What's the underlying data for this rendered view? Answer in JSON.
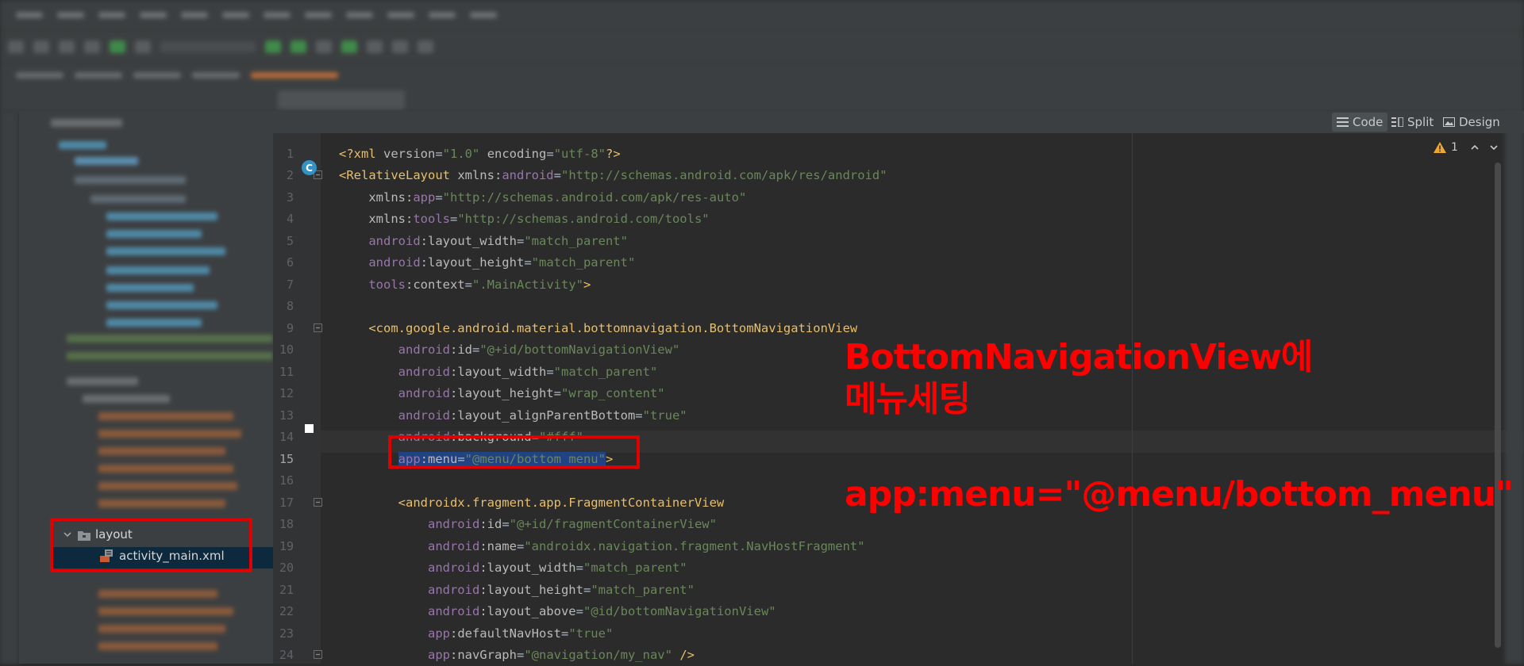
{
  "editor": {
    "view_modes": [
      "Code",
      "Split",
      "Design"
    ],
    "active_view": "Code",
    "inspection_count": "1",
    "lines": [
      {
        "num": "1",
        "tokens": [
          [
            "pi",
            "<?xml "
          ],
          [
            "at",
            "version"
          ],
          [
            "pl",
            "="
          ],
          [
            "val",
            "\"1.0\""
          ],
          [
            "pl",
            " "
          ],
          [
            "at",
            "encoding"
          ],
          [
            "pl",
            "="
          ],
          [
            "val",
            "\"utf-8\""
          ],
          [
            "pi",
            "?>"
          ]
        ]
      },
      {
        "num": "2",
        "tokens": [
          [
            "tag",
            "<RelativeLayout "
          ],
          [
            "at",
            "xmlns:"
          ],
          [
            "ns",
            "android"
          ],
          [
            "pl",
            "="
          ],
          [
            "val",
            "\"http://schemas.android.com/apk/res/android\""
          ]
        ]
      },
      {
        "num": "3",
        "tokens": [
          [
            "pl",
            "    "
          ],
          [
            "at",
            "xmlns:"
          ],
          [
            "ns",
            "app"
          ],
          [
            "pl",
            "="
          ],
          [
            "val",
            "\"http://schemas.android.com/apk/res-auto\""
          ]
        ]
      },
      {
        "num": "4",
        "tokens": [
          [
            "pl",
            "    "
          ],
          [
            "at",
            "xmlns:"
          ],
          [
            "ns",
            "tools"
          ],
          [
            "pl",
            "="
          ],
          [
            "val",
            "\"http://schemas.android.com/tools\""
          ]
        ]
      },
      {
        "num": "5",
        "tokens": [
          [
            "pl",
            "    "
          ],
          [
            "ns",
            "android"
          ],
          [
            "at",
            ":layout_width"
          ],
          [
            "pl",
            "="
          ],
          [
            "val",
            "\"match_parent\""
          ]
        ]
      },
      {
        "num": "6",
        "tokens": [
          [
            "pl",
            "    "
          ],
          [
            "ns",
            "android"
          ],
          [
            "at",
            ":layout_height"
          ],
          [
            "pl",
            "="
          ],
          [
            "val",
            "\"match_parent\""
          ]
        ]
      },
      {
        "num": "7",
        "tokens": [
          [
            "pl",
            "    "
          ],
          [
            "ns",
            "tools"
          ],
          [
            "at",
            ":context"
          ],
          [
            "pl",
            "="
          ],
          [
            "val",
            "\".MainActivity\""
          ],
          [
            "tag",
            ">"
          ]
        ]
      },
      {
        "num": "8",
        "tokens": []
      },
      {
        "num": "9",
        "tokens": [
          [
            "pl",
            "    "
          ],
          [
            "tag",
            "<com.google.android.material.bottomnavigation.BottomNavigationView"
          ]
        ]
      },
      {
        "num": "10",
        "tokens": [
          [
            "pl",
            "        "
          ],
          [
            "ns",
            "android"
          ],
          [
            "at",
            ":id"
          ],
          [
            "pl",
            "="
          ],
          [
            "val",
            "\"@+id/bottomNavigationView\""
          ]
        ]
      },
      {
        "num": "11",
        "tokens": [
          [
            "pl",
            "        "
          ],
          [
            "ns",
            "android"
          ],
          [
            "at",
            ":layout_width"
          ],
          [
            "pl",
            "="
          ],
          [
            "val",
            "\"match_parent\""
          ]
        ]
      },
      {
        "num": "12",
        "tokens": [
          [
            "pl",
            "        "
          ],
          [
            "ns",
            "android"
          ],
          [
            "at",
            ":layout_height"
          ],
          [
            "pl",
            "="
          ],
          [
            "val",
            "\"wrap_content\""
          ]
        ]
      },
      {
        "num": "13",
        "tokens": [
          [
            "pl",
            "        "
          ],
          [
            "ns",
            "android"
          ],
          [
            "at",
            ":layout_alignParentBottom"
          ],
          [
            "pl",
            "="
          ],
          [
            "val",
            "\"true\""
          ]
        ]
      },
      {
        "num": "14",
        "tokens": [
          [
            "pl",
            "        "
          ],
          [
            "ns",
            "android"
          ],
          [
            "at",
            ":background"
          ],
          [
            "pl",
            "="
          ],
          [
            "val",
            "\"#fff\""
          ]
        ]
      },
      {
        "num": "15",
        "tokens": [
          [
            "pl",
            "        "
          ],
          [
            "nsS",
            "app"
          ],
          [
            "atS",
            ":menu"
          ],
          [
            "plS",
            "="
          ],
          [
            "valS",
            "\"@menu/bottom_menu\""
          ],
          [
            "tag",
            ">"
          ]
        ]
      },
      {
        "num": "16",
        "tokens": []
      },
      {
        "num": "17",
        "tokens": [
          [
            "pl",
            "        "
          ],
          [
            "tag",
            "<androidx.fragment.app.FragmentContainerView"
          ]
        ]
      },
      {
        "num": "18",
        "tokens": [
          [
            "pl",
            "            "
          ],
          [
            "ns",
            "android"
          ],
          [
            "at",
            ":id"
          ],
          [
            "pl",
            "="
          ],
          [
            "val",
            "\"@+id/fragmentContainerView\""
          ]
        ]
      },
      {
        "num": "19",
        "tokens": [
          [
            "pl",
            "            "
          ],
          [
            "ns",
            "android"
          ],
          [
            "at",
            ":name"
          ],
          [
            "pl",
            "="
          ],
          [
            "val",
            "\"androidx.navigation.fragment.NavHostFragment\""
          ]
        ]
      },
      {
        "num": "20",
        "tokens": [
          [
            "pl",
            "            "
          ],
          [
            "ns",
            "android"
          ],
          [
            "at",
            ":layout_width"
          ],
          [
            "pl",
            "="
          ],
          [
            "val",
            "\"match_parent\""
          ]
        ]
      },
      {
        "num": "21",
        "tokens": [
          [
            "pl",
            "            "
          ],
          [
            "ns",
            "android"
          ],
          [
            "at",
            ":layout_height"
          ],
          [
            "pl",
            "="
          ],
          [
            "val",
            "\"match_parent\""
          ]
        ]
      },
      {
        "num": "22",
        "tokens": [
          [
            "pl",
            "            "
          ],
          [
            "ns",
            "android"
          ],
          [
            "at",
            ":layout_above"
          ],
          [
            "pl",
            "="
          ],
          [
            "val",
            "\"@id/bottomNavigationView\""
          ]
        ]
      },
      {
        "num": "23",
        "tokens": [
          [
            "pl",
            "            "
          ],
          [
            "ns",
            "app"
          ],
          [
            "at",
            ":defaultNavHost"
          ],
          [
            "pl",
            "="
          ],
          [
            "val",
            "\"true\""
          ]
        ]
      },
      {
        "num": "24",
        "tokens": [
          [
            "pl",
            "            "
          ],
          [
            "ns",
            "app"
          ],
          [
            "at",
            ":navGraph"
          ],
          [
            "pl",
            "="
          ],
          [
            "val",
            "\"@navigation/my_nav\""
          ],
          [
            "pl",
            " "
          ],
          [
            "tag",
            "/>"
          ]
        ]
      }
    ],
    "current_line": "15"
  },
  "project_tree": {
    "folder_label": "layout",
    "file_label": "activity_main.xml"
  },
  "annotations": {
    "line1": "BottomNavigationView에",
    "line2": "메뉴세팅",
    "line3": "app:menu=\"@menu/bottom_menu\""
  },
  "colors": {
    "annotation_red": "#ff0000",
    "selection_blue": "#214283",
    "editor_bg": "#2b2b2b"
  }
}
